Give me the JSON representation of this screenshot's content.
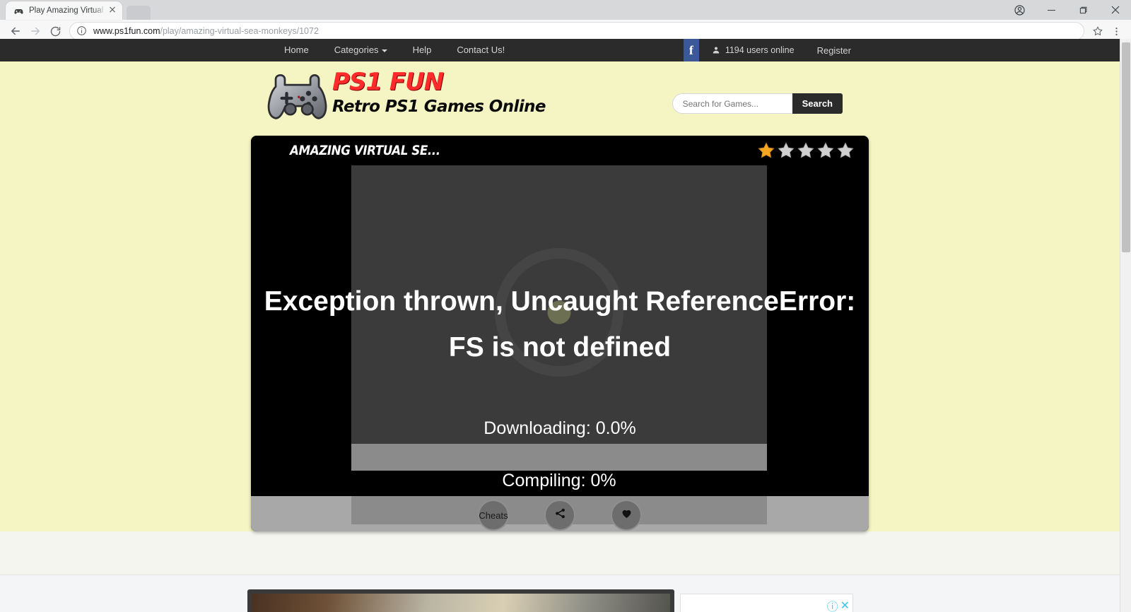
{
  "browser": {
    "tab": {
      "title": "Play Amazing Virtual Sea",
      "favicon": "gamepad-icon",
      "close": "×"
    },
    "new_tab_label": "",
    "window_controls": {
      "profile": "profile-icon",
      "minimize": "−",
      "maximize": "❐",
      "close": "✕"
    },
    "nav": {
      "back": "←",
      "forward": "→",
      "reload": "⟳"
    },
    "omnibox": {
      "security_icon": "info-circle-icon",
      "url_domain": "www.ps1fun.com",
      "url_path": "/play/amazing-virtual-sea-monkeys/1072",
      "bookmark_icon": "star-icon",
      "menu_icon": "three-dot-menu-icon"
    }
  },
  "site": {
    "topnav": {
      "links": [
        {
          "label": "Home"
        },
        {
          "label": "Categories",
          "has_caret": true
        },
        {
          "label": "Help"
        },
        {
          "label": "Contact Us!"
        }
      ],
      "facebook_label": "f",
      "users_online": "1194 users online",
      "register_label": "Register"
    },
    "header": {
      "logo_title": "PS1 FUN",
      "logo_subtitle": "Retro PS1 Games Online",
      "search_placeholder": "Search for Games...",
      "search_value": "",
      "search_button": "Search"
    },
    "game": {
      "title": "AMAZING VIRTUAL SE...",
      "rating": {
        "filled": 1,
        "total": 5,
        "filled_color": "#f5a623",
        "empty_color": "#d0d0d0"
      },
      "error_message": "Exception thrown, Uncaught ReferenceError: FS is not defined",
      "downloading": "Downloading: 0.0%",
      "download_percent": 0,
      "compiling": "Compiling: 0%",
      "compile_percent": 0,
      "controls": [
        {
          "label": "Cheats",
          "icon": "cheats-text"
        },
        {
          "label": "",
          "icon": "share-icon"
        },
        {
          "label": "",
          "icon": "heart-icon"
        }
      ]
    },
    "ad": {
      "adchoices_info": "ⓘ",
      "adchoices_close": "✕"
    }
  },
  "colors": {
    "page_bg": "#f5f5c4",
    "nav_bg": "#2b2b2b",
    "logo_red": "#ff2a2a",
    "facebook_blue": "#3b5998",
    "canvas_bg": "#3b3b3b",
    "progress_bg": "#8b8b8b",
    "footer_bg": "#a8a8a8"
  }
}
